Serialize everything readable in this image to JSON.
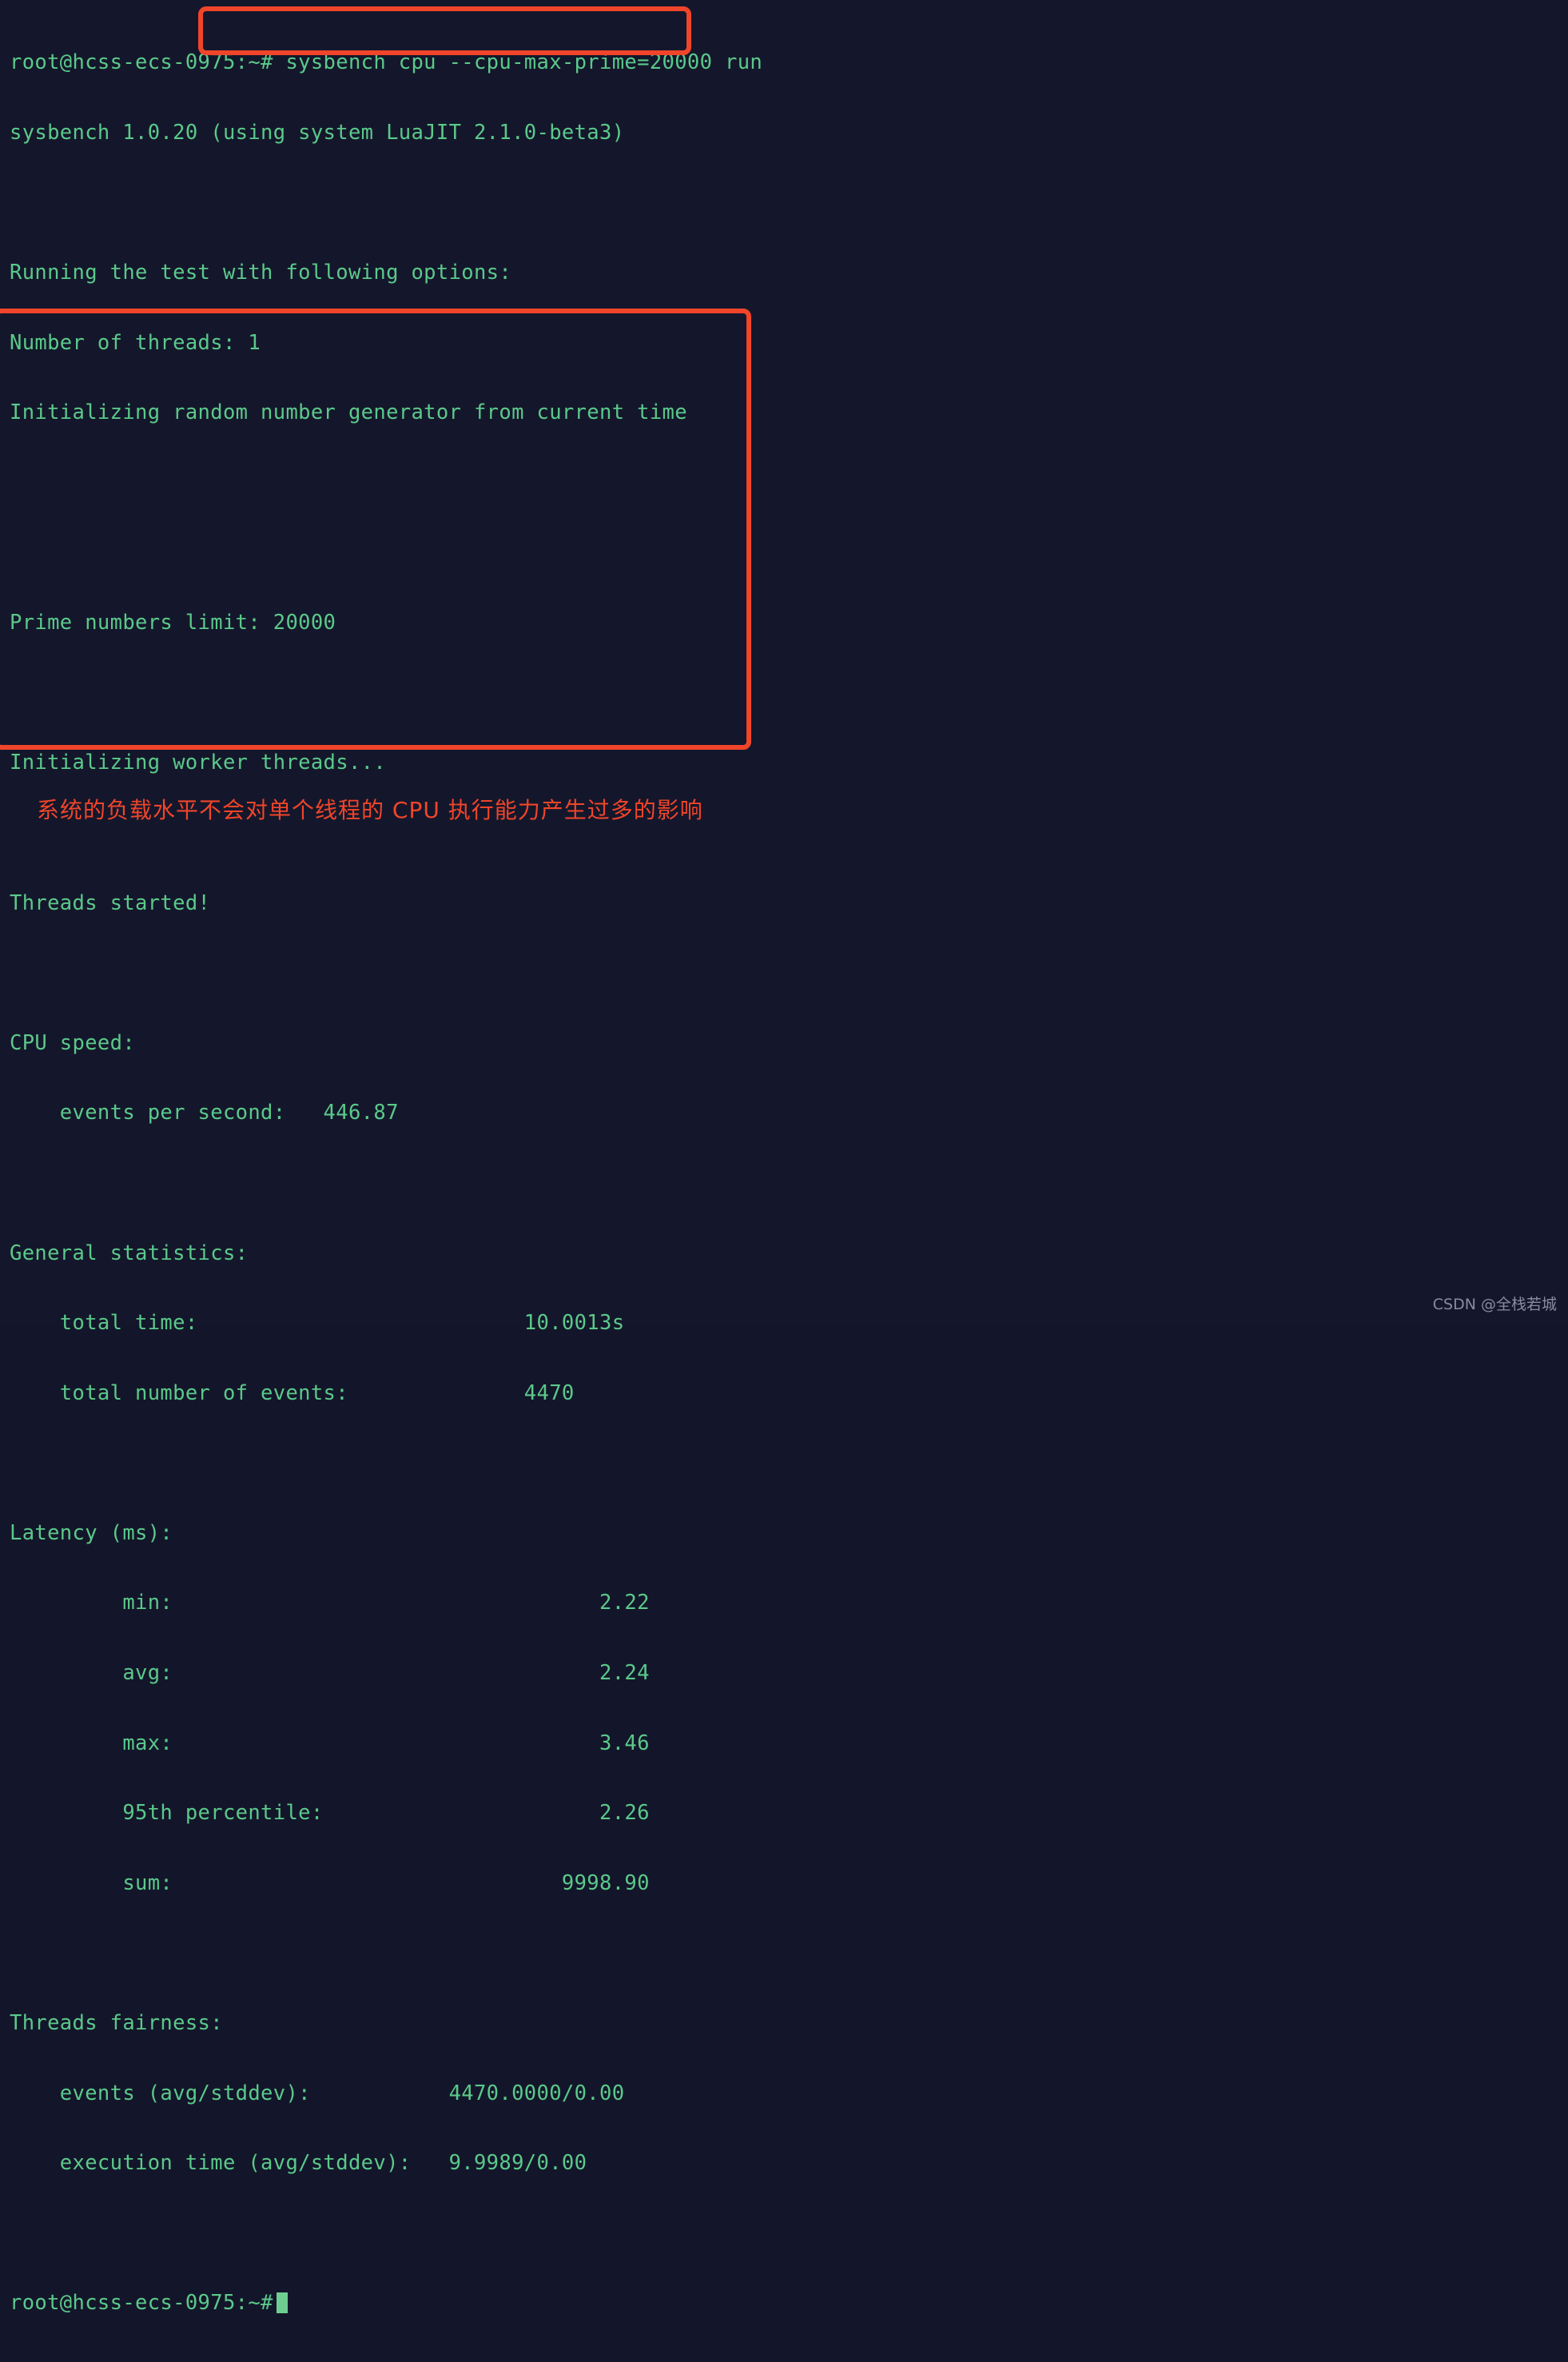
{
  "terminal": {
    "background_color": "#14172b",
    "text_color": "#5bc98a",
    "prompt": "root@hcss-ecs-0975:~#",
    "lines": [
      "root@hcss-ecs-0975:~# sysbench cpu --cpu-max-prime=20000 run",
      "sysbench 1.0.20 (using system LuaJIT 2.1.0-beta3)",
      "",
      "Running the test with following options:",
      "Number of threads: 1",
      "Initializing random number generator from current time",
      "",
      "",
      "Prime numbers limit: 20000",
      "",
      "Initializing worker threads...",
      "",
      "Threads started!",
      "",
      "CPU speed:",
      "    events per second:   446.87",
      "",
      "General statistics:",
      "    total time:                          10.0013s",
      "    total number of events:              4470",
      "",
      "Latency (ms):",
      "         min:                                  2.22",
      "         avg:                                  2.24",
      "         max:                                  3.46",
      "         95th percentile:                      2.26",
      "         sum:                               9998.90",
      "",
      "Threads fairness:",
      "    events (avg/stddev):           4470.0000/0.00",
      "    execution time (avg/stddev):   9.9989/0.00",
      "",
      "root@hcss-ecs-0975:~#"
    ]
  },
  "command": {
    "full": "sysbench cpu --cpu-max-prime=20000 run",
    "program": "sysbench",
    "subcommand": "cpu",
    "option": "--cpu-max-prime=20000",
    "action": "run"
  },
  "version_line": {
    "name": "sysbench",
    "version": "1.0.20",
    "engine": "using system LuaJIT 2.1.0-beta3"
  },
  "options": {
    "header": "Running the test with following options:",
    "number_of_threads_label": "Number of threads:",
    "number_of_threads_value": "1",
    "rng_note": "Initializing random number generator from current time",
    "prime_limit_label": "Prime numbers limit:",
    "prime_limit_value": "20000",
    "init_workers": "Initializing worker threads...",
    "threads_started": "Threads started!"
  },
  "results": {
    "cpu_speed": {
      "header": "CPU speed:",
      "events_per_second_label": "events per second:",
      "events_per_second_value": "446.87"
    },
    "general_statistics": {
      "header": "General statistics:",
      "rows": [
        {
          "label": "total time:",
          "value": "10.0013s"
        },
        {
          "label": "total number of events:",
          "value": "4470"
        }
      ]
    },
    "latency": {
      "header": "Latency (ms):",
      "rows": [
        {
          "label": "min:",
          "value": "2.22"
        },
        {
          "label": "avg:",
          "value": "2.24"
        },
        {
          "label": "max:",
          "value": "3.46"
        },
        {
          "label": "95th percentile:",
          "value": "2.26"
        },
        {
          "label": "sum:",
          "value": "9998.90"
        }
      ]
    },
    "threads_fairness": {
      "header": "Threads fairness:",
      "rows": [
        {
          "label": "events (avg/stddev):",
          "value": "4470.0000/0.00"
        },
        {
          "label": "execution time (avg/stddev):",
          "value": "9.9989/0.00"
        }
      ]
    }
  },
  "annotations": {
    "color": "#f0452a",
    "command_box_label": "command-highlight-box",
    "results_box_label": "results-highlight-box",
    "note": "系统的负载水平不会对单个线程的 CPU 执行能力产生过多的影响"
  },
  "watermark": {
    "text": "CSDN @全栈若城"
  }
}
